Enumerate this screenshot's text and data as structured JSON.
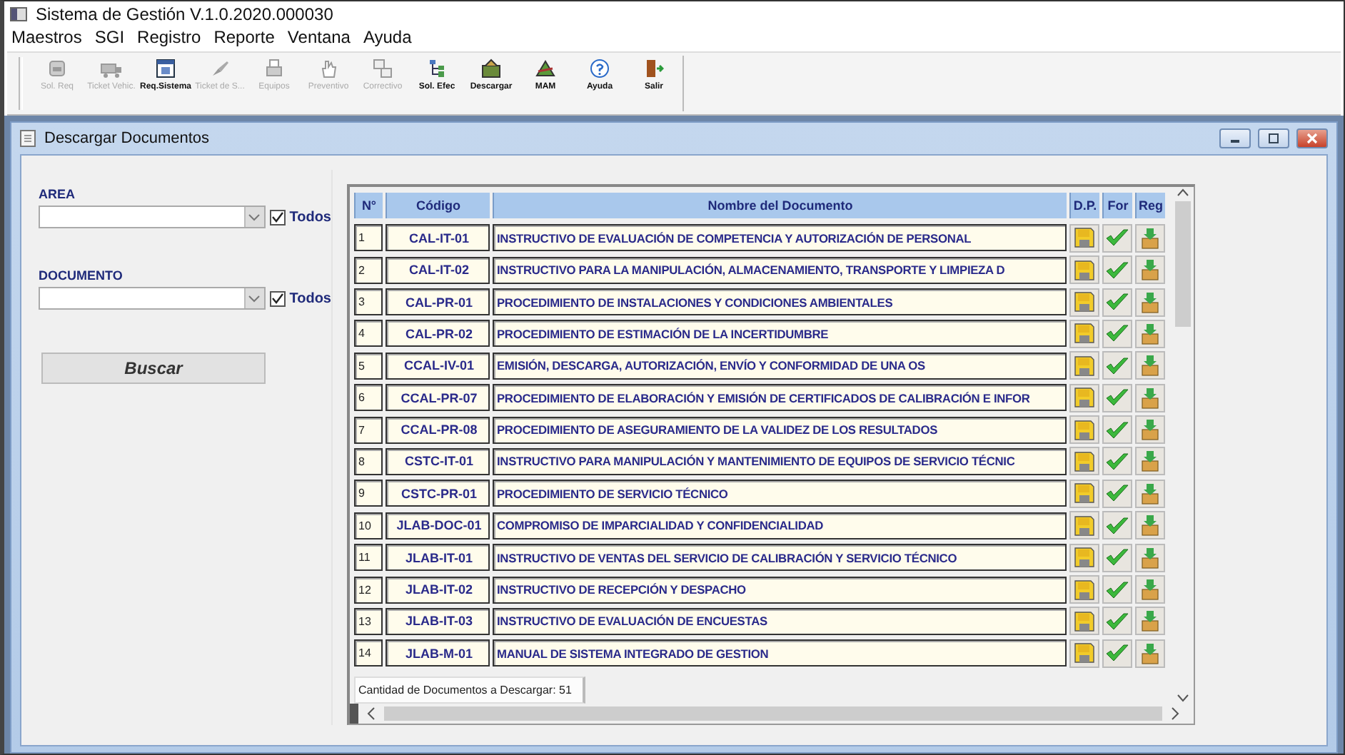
{
  "window": {
    "title": "Sistema de Gestión V.1.0.2020.000030"
  },
  "menu": [
    "Maestros",
    "SGI",
    "Registro",
    "Reporte",
    "Ventana",
    "Ayuda"
  ],
  "toolbar": [
    {
      "label": "Sol. Req",
      "kind": "req",
      "disabled": true
    },
    {
      "label": "Ticket Vehic.",
      "kind": "truck",
      "disabled": true
    },
    {
      "label": "Req.Sistema",
      "kind": "calendar",
      "disabled": false
    },
    {
      "label": "Ticket de S...",
      "kind": "brush",
      "disabled": true
    },
    {
      "label": "Equipos",
      "kind": "printer",
      "disabled": true
    },
    {
      "label": "Preventivo",
      "kind": "hand",
      "disabled": true
    },
    {
      "label": "Correctivo",
      "kind": "boxes",
      "disabled": true
    },
    {
      "label": "Sol. Efec",
      "kind": "tree",
      "disabled": false
    },
    {
      "label": "Descargar",
      "kind": "download",
      "disabled": false
    },
    {
      "label": "MAM",
      "kind": "tools",
      "disabled": false
    },
    {
      "label": "Ayuda",
      "kind": "help",
      "disabled": false
    },
    {
      "label": "Salir",
      "kind": "exit",
      "disabled": false
    }
  ],
  "child": {
    "title": "Descargar Documentos",
    "filters": [
      {
        "label": "AREA",
        "checkbox_label": "Todos",
        "checked": true
      },
      {
        "label": "DOCUMENTO",
        "checkbox_label": "Todos",
        "checked": true
      }
    ],
    "search_button": "Buscar",
    "table": {
      "columns": [
        "N°",
        "Código",
        "Nombre del Documento",
        "D.P.",
        "For",
        "Reg"
      ],
      "rows": [
        {
          "n": "1",
          "code": "CAL-IT-01",
          "name": "INSTRUCTIVO DE EVALUACIÓN DE COMPETENCIA Y AUTORIZACIÓN DE PERSONAL"
        },
        {
          "n": "2",
          "code": "CAL-IT-02",
          "name": "INSTRUCTIVO PARA LA MANIPULACIÓN, ALMACENAMIENTO, TRANSPORTE Y LIMPIEZA D"
        },
        {
          "n": "3",
          "code": "CAL-PR-01",
          "name": "PROCEDIMIENTO DE INSTALACIONES Y CONDICIONES AMBIENTALES"
        },
        {
          "n": "4",
          "code": "CAL-PR-02",
          "name": "PROCEDIMIENTO DE ESTIMACIÓN DE LA INCERTIDUMBRE"
        },
        {
          "n": "5",
          "code": "CCAL-IV-01",
          "name": "EMISIÓN, DESCARGA, AUTORIZACIÓN, ENVÍO Y CONFORMIDAD DE UNA OS"
        },
        {
          "n": "6",
          "code": "CCAL-PR-07",
          "name": "PROCEDIMIENTO DE ELABORACIÓN Y EMISIÓN DE CERTIFICADOS DE CALIBRACIÓN E INFOR"
        },
        {
          "n": "7",
          "code": "CCAL-PR-08",
          "name": "PROCEDIMIENTO DE ASEGURAMIENTO DE LA VALIDEZ DE LOS RESULTADOS"
        },
        {
          "n": "8",
          "code": "CSTC-IT-01",
          "name": "INSTRUCTIVO PARA MANIPULACIÓN Y MANTENIMIENTO DE EQUIPOS DE SERVICIO TÉCNIC"
        },
        {
          "n": "9",
          "code": "CSTC-PR-01",
          "name": "PROCEDIMIENTO DE SERVICIO TÉCNICO"
        },
        {
          "n": "10",
          "code": "JLAB-DOC-01",
          "name": "COMPROMISO DE IMPARCIALIDAD Y CONFIDENCIALIDAD"
        },
        {
          "n": "11",
          "code": "JLAB-IT-01",
          "name": "INSTRUCTIVO DE VENTAS DEL SERVICIO DE CALIBRACIÓN Y SERVICIO TÉCNICO"
        },
        {
          "n": "12",
          "code": "JLAB-IT-02",
          "name": "INSTRUCTIVO DE RECEPCIÓN Y DESPACHO"
        },
        {
          "n": "13",
          "code": "JLAB-IT-03",
          "name": "INSTRUCTIVO DE EVALUACIÓN DE ENCUESTAS"
        },
        {
          "n": "14",
          "code": "JLAB-M-01",
          "name": "MANUAL DE SISTEMA INTEGRADO DE GESTION"
        }
      ]
    },
    "count": "Cantidad de Documentos a Descargar: 51"
  }
}
